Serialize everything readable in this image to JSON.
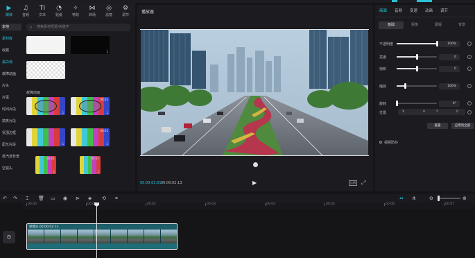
{
  "toolbar": {
    "tools": [
      {
        "label": "媒体",
        "icon": "media-icon",
        "glyph": "▶",
        "active": true
      },
      {
        "label": "音频",
        "icon": "audio-icon",
        "glyph": "♫"
      },
      {
        "label": "文本",
        "icon": "text-icon",
        "glyph": "TI"
      },
      {
        "label": "贴纸",
        "icon": "sticker-icon",
        "glyph": "◔"
      },
      {
        "label": "特效",
        "icon": "effects-icon",
        "glyph": "✧"
      },
      {
        "label": "转场",
        "icon": "transition-icon",
        "glyph": "⋈"
      },
      {
        "label": "滤镜",
        "icon": "filter-icon",
        "glyph": "◎"
      },
      {
        "label": "调节",
        "icon": "adjust-icon",
        "glyph": "⚙"
      }
    ]
  },
  "sidebar": {
    "items": [
      {
        "label": "本地",
        "state": "active"
      },
      {
        "label": "素材库",
        "state": "sel"
      },
      {
        "label": "收藏",
        "state": ""
      },
      {
        "label": "黑白场",
        "state": "sel"
      },
      {
        "label": "故障动画",
        "state": ""
      },
      {
        "label": "片头",
        "state": ""
      },
      {
        "label": "片尾",
        "state": ""
      },
      {
        "label": "时间片段",
        "state": ""
      },
      {
        "label": "搞笑片段",
        "state": ""
      },
      {
        "label": "氛围边框",
        "state": ""
      },
      {
        "label": "配乐片段",
        "state": ""
      },
      {
        "label": "蒸汽波背景",
        "state": ""
      },
      {
        "label": "空镜头",
        "state": ""
      }
    ]
  },
  "media": {
    "search_placeholder": "搜索素材短语/关键字",
    "section_label": "故障动画",
    "thumbs": [
      {
        "kind": "white",
        "dur": ""
      },
      {
        "kind": "black",
        "dur": ""
      },
      {
        "kind": "checker",
        "dur": ""
      },
      {
        "kind": "testcard",
        "dur": ""
      },
      {
        "kind": "testcard",
        "dur": "00:01"
      },
      {
        "kind": "bars",
        "dur": ""
      },
      {
        "kind": "bars",
        "dur": "00:01"
      },
      {
        "kind": "vbars",
        "dur": "00:01"
      },
      {
        "kind": "vbars",
        "dur": "00:01"
      }
    ]
  },
  "player": {
    "title": "播放器",
    "current_time": "00:00:03:01",
    "total_time": "00:00:02:13",
    "ratio_label": "比例",
    "play_icon": "▶",
    "fullscreen_icon": "⤢"
  },
  "inspector": {
    "tabs": [
      "画面",
      "音频",
      "变速",
      "动画",
      "调节"
    ],
    "subtabs": [
      "基础",
      "抠像",
      "蒙版",
      "背景"
    ],
    "props": [
      {
        "label": "不透明度",
        "value": "100%",
        "fill": 1.0
      },
      {
        "label": "亮度",
        "value": "0",
        "fill": 0.5
      },
      {
        "label": "饱和",
        "value": "0",
        "fill": 0.5
      },
      {
        "label": "缩放",
        "value": "100%",
        "fill": 0.2
      },
      {
        "label": "旋转",
        "value": "0°",
        "fill": 0.0
      }
    ],
    "position_label": "位置",
    "pos_x_label": "X",
    "pos_x": "0",
    "pos_y_label": "Y",
    "pos_y": "0",
    "reset_label": "重置",
    "apply_all_label": "应用到全部",
    "bg_toggle_label": "视频防抖"
  },
  "timeline": {
    "ruler": [
      "00:00",
      "00:01",
      "00:02",
      "00:03",
      "00:04",
      "00:05",
      "00:06",
      "00:07"
    ],
    "clip_label": "空镜头  00:00:02:13",
    "tools_left": [
      {
        "glyph": "↶",
        "icon": "undo-icon"
      },
      {
        "glyph": "↷",
        "icon": "redo-icon"
      },
      {
        "glyph": "⌶",
        "icon": "split-icon"
      },
      {
        "glyph": "🗑",
        "icon": "delete-icon"
      },
      {
        "glyph": "▭",
        "icon": "freeze-icon"
      },
      {
        "glyph": "◉",
        "icon": "record-icon"
      },
      {
        "glyph": "⊳",
        "icon": "reverse-icon"
      },
      {
        "glyph": "◈",
        "icon": "mirror-icon"
      },
      {
        "glyph": "⟲",
        "icon": "rotate-icon"
      },
      {
        "glyph": "⌗",
        "icon": "crop-icon"
      }
    ],
    "tools_right": [
      {
        "glyph": "⇔",
        "icon": "snap-icon",
        "accent": true
      },
      {
        "glyph": "⋔",
        "icon": "link-icon"
      },
      {
        "glyph": "⊖",
        "icon": "zoom-out-icon"
      },
      {
        "glyph": "⊕",
        "icon": "zoom-in-icon"
      }
    ],
    "cover_icon": "⊙"
  },
  "colors": {
    "accent": "#2bc1d6",
    "panel": "#1c1c20",
    "clip": "#1f5f6a"
  }
}
